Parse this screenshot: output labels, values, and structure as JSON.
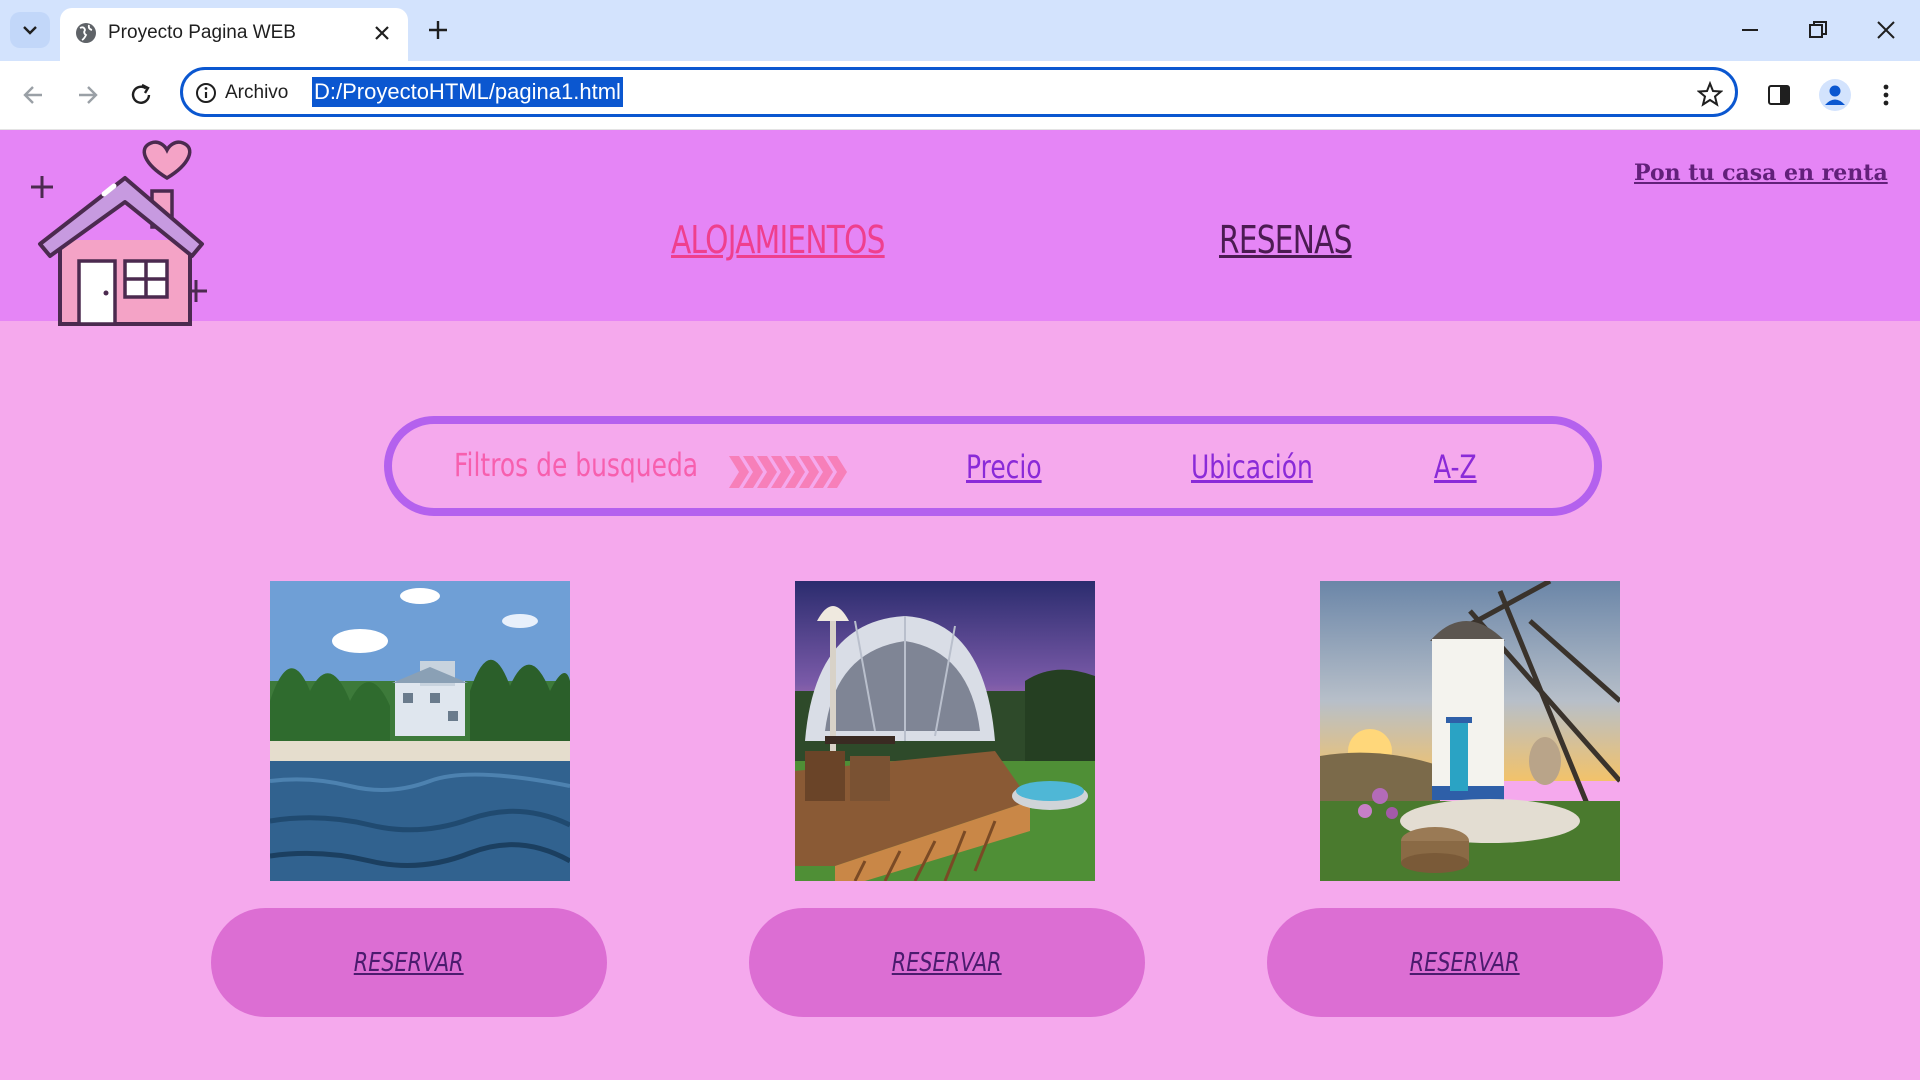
{
  "browser": {
    "tab_title": "Proyecto Pagina WEB",
    "scheme_label": "Archivo",
    "url": "D:/ProyectoHTML/pagina1.html"
  },
  "header": {
    "nav": [
      "ALOJAMIENTOS",
      "RESENAS"
    ],
    "rent_link": "Pon tu casa en renta"
  },
  "filters": {
    "label": "Filtros de busqueda",
    "options": [
      "Precio",
      "Ubicación",
      "A-Z"
    ]
  },
  "listings": [
    {
      "image": "beach-house-photo",
      "button": "RESERVAR"
    },
    {
      "image": "glamping-dome-photo",
      "button": "RESERVAR"
    },
    {
      "image": "windmill-photo",
      "button": "RESERVAR"
    }
  ],
  "colors": {
    "header_bg": "#e585f6",
    "page_bg": "#f5a9ed",
    "filter_border": "#b461ee",
    "button_bg": "#dc6ed3",
    "accent_pink": "#ef3f8e"
  }
}
